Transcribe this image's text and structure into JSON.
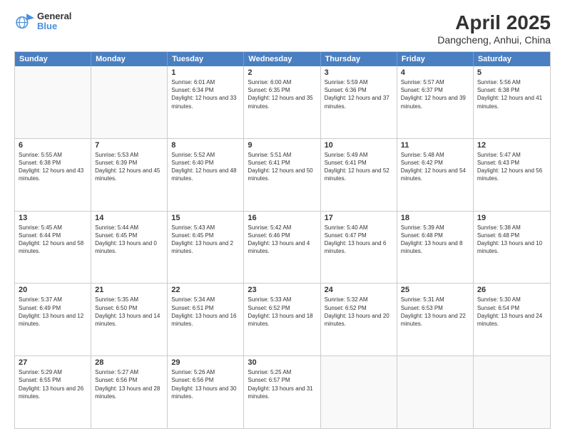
{
  "header": {
    "title": "April 2025",
    "subtitle": "Dangcheng, Anhui, China",
    "logo_line1": "General",
    "logo_line2": "Blue"
  },
  "days": [
    "Sunday",
    "Monday",
    "Tuesday",
    "Wednesday",
    "Thursday",
    "Friday",
    "Saturday"
  ],
  "weeks": [
    [
      {
        "day": "",
        "detail": ""
      },
      {
        "day": "",
        "detail": ""
      },
      {
        "day": "1",
        "detail": "Sunrise: 6:01 AM\nSunset: 6:34 PM\nDaylight: 12 hours and 33 minutes."
      },
      {
        "day": "2",
        "detail": "Sunrise: 6:00 AM\nSunset: 6:35 PM\nDaylight: 12 hours and 35 minutes."
      },
      {
        "day": "3",
        "detail": "Sunrise: 5:59 AM\nSunset: 6:36 PM\nDaylight: 12 hours and 37 minutes."
      },
      {
        "day": "4",
        "detail": "Sunrise: 5:57 AM\nSunset: 6:37 PM\nDaylight: 12 hours and 39 minutes."
      },
      {
        "day": "5",
        "detail": "Sunrise: 5:56 AM\nSunset: 6:38 PM\nDaylight: 12 hours and 41 minutes."
      }
    ],
    [
      {
        "day": "6",
        "detail": "Sunrise: 5:55 AM\nSunset: 6:38 PM\nDaylight: 12 hours and 43 minutes."
      },
      {
        "day": "7",
        "detail": "Sunrise: 5:53 AM\nSunset: 6:39 PM\nDaylight: 12 hours and 45 minutes."
      },
      {
        "day": "8",
        "detail": "Sunrise: 5:52 AM\nSunset: 6:40 PM\nDaylight: 12 hours and 48 minutes."
      },
      {
        "day": "9",
        "detail": "Sunrise: 5:51 AM\nSunset: 6:41 PM\nDaylight: 12 hours and 50 minutes."
      },
      {
        "day": "10",
        "detail": "Sunrise: 5:49 AM\nSunset: 6:41 PM\nDaylight: 12 hours and 52 minutes."
      },
      {
        "day": "11",
        "detail": "Sunrise: 5:48 AM\nSunset: 6:42 PM\nDaylight: 12 hours and 54 minutes."
      },
      {
        "day": "12",
        "detail": "Sunrise: 5:47 AM\nSunset: 6:43 PM\nDaylight: 12 hours and 56 minutes."
      }
    ],
    [
      {
        "day": "13",
        "detail": "Sunrise: 5:45 AM\nSunset: 6:44 PM\nDaylight: 12 hours and 58 minutes."
      },
      {
        "day": "14",
        "detail": "Sunrise: 5:44 AM\nSunset: 6:45 PM\nDaylight: 13 hours and 0 minutes."
      },
      {
        "day": "15",
        "detail": "Sunrise: 5:43 AM\nSunset: 6:45 PM\nDaylight: 13 hours and 2 minutes."
      },
      {
        "day": "16",
        "detail": "Sunrise: 5:42 AM\nSunset: 6:46 PM\nDaylight: 13 hours and 4 minutes."
      },
      {
        "day": "17",
        "detail": "Sunrise: 5:40 AM\nSunset: 6:47 PM\nDaylight: 13 hours and 6 minutes."
      },
      {
        "day": "18",
        "detail": "Sunrise: 5:39 AM\nSunset: 6:48 PM\nDaylight: 13 hours and 8 minutes."
      },
      {
        "day": "19",
        "detail": "Sunrise: 5:38 AM\nSunset: 6:48 PM\nDaylight: 13 hours and 10 minutes."
      }
    ],
    [
      {
        "day": "20",
        "detail": "Sunrise: 5:37 AM\nSunset: 6:49 PM\nDaylight: 13 hours and 12 minutes."
      },
      {
        "day": "21",
        "detail": "Sunrise: 5:35 AM\nSunset: 6:50 PM\nDaylight: 13 hours and 14 minutes."
      },
      {
        "day": "22",
        "detail": "Sunrise: 5:34 AM\nSunset: 6:51 PM\nDaylight: 13 hours and 16 minutes."
      },
      {
        "day": "23",
        "detail": "Sunrise: 5:33 AM\nSunset: 6:52 PM\nDaylight: 13 hours and 18 minutes."
      },
      {
        "day": "24",
        "detail": "Sunrise: 5:32 AM\nSunset: 6:52 PM\nDaylight: 13 hours and 20 minutes."
      },
      {
        "day": "25",
        "detail": "Sunrise: 5:31 AM\nSunset: 6:53 PM\nDaylight: 13 hours and 22 minutes."
      },
      {
        "day": "26",
        "detail": "Sunrise: 5:30 AM\nSunset: 6:54 PM\nDaylight: 13 hours and 24 minutes."
      }
    ],
    [
      {
        "day": "27",
        "detail": "Sunrise: 5:29 AM\nSunset: 6:55 PM\nDaylight: 13 hours and 26 minutes."
      },
      {
        "day": "28",
        "detail": "Sunrise: 5:27 AM\nSunset: 6:56 PM\nDaylight: 13 hours and 28 minutes."
      },
      {
        "day": "29",
        "detail": "Sunrise: 5:26 AM\nSunset: 6:56 PM\nDaylight: 13 hours and 30 minutes."
      },
      {
        "day": "30",
        "detail": "Sunrise: 5:25 AM\nSunset: 6:57 PM\nDaylight: 13 hours and 31 minutes."
      },
      {
        "day": "",
        "detail": ""
      },
      {
        "day": "",
        "detail": ""
      },
      {
        "day": "",
        "detail": ""
      }
    ]
  ]
}
